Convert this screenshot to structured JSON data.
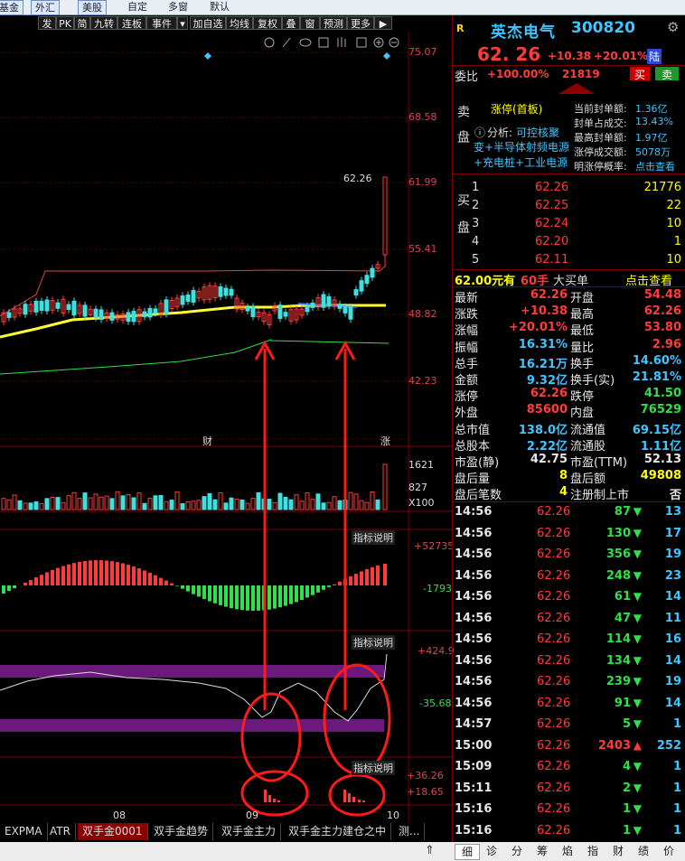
{
  "top_menu": {
    "items": [
      "基金",
      "外汇",
      "美股",
      "自定",
      "多窗",
      "默认"
    ]
  },
  "toolbar": {
    "buttons": [
      "发",
      "PK",
      "简",
      "九转",
      "连板",
      "事件",
      "▾",
      "加自选",
      "均线",
      "复权",
      "叠",
      "窗",
      "预测",
      "更多",
      "▶"
    ]
  },
  "chart_axis": {
    "price_ticks": [
      "75.07",
      "68.58",
      "61.99",
      "55.41",
      "48.82",
      "42.23"
    ],
    "high_label": "62.26",
    "marker_cai": "财",
    "marker_zhang": "涨"
  },
  "volume_panel": {
    "ticks": [
      "1621",
      "827",
      "X100"
    ]
  },
  "indicator1": {
    "button": "指标说明",
    "ticks": [
      "+52735",
      "-1793"
    ]
  },
  "indicator2": {
    "button": "指标说明",
    "ticks": [
      "+424.9",
      "-35.68"
    ]
  },
  "indicator3": {
    "button": "指标说明",
    "ticks": [
      "+36.26",
      "+18.65"
    ]
  },
  "date_axis": [
    "08",
    "09",
    "10"
  ],
  "bottom_tabs": [
    "EXPMA",
    "ATR",
    "双手金0001",
    "双手金趋势",
    "双手金主力",
    "双手金主力建仓之中",
    "测..."
  ],
  "stock": {
    "logo": "R",
    "name": "英杰电气",
    "code": "300820",
    "price": "62. 26",
    "change": "+10.38",
    "change_pct": "+20.01%",
    "board_tag": "陆",
    "weibi_label": "委比",
    "weibi_value": "+100.00%",
    "weicha_value": "21819",
    "sell_btn": "买",
    "buy_btn": "卖"
  },
  "limit_info": {
    "side_label_sell": "卖盘",
    "status": "涨停(首板)",
    "analysis_label": "分析:",
    "analysis_value": "可控核聚",
    "concept1": "变+半导体射频电源",
    "concept2": "+充电桩+工业电源",
    "stats": [
      {
        "label": "当前封单额:",
        "value": "1.36亿"
      },
      {
        "label": "封单占成交:",
        "value": "13.43%"
      },
      {
        "label": "最高封单额:",
        "value": "1.97亿"
      },
      {
        "label": "涨停成交额:",
        "value": "5078万"
      },
      {
        "label": "明涨停概率:",
        "value": "点击查看"
      }
    ]
  },
  "buy_book": {
    "side_label": "买盘",
    "rows": [
      {
        "level": "1",
        "price": "62.26",
        "vol": "21776"
      },
      {
        "level": "2",
        "price": "62.25",
        "vol": "22"
      },
      {
        "level": "3",
        "price": "62.24",
        "vol": "10"
      },
      {
        "level": "4",
        "price": "62.20",
        "vol": "1"
      },
      {
        "level": "5",
        "price": "62.11",
        "vol": "10"
      }
    ]
  },
  "big_order": {
    "amount": "62.00元有",
    "hands": "60手",
    "label": "大买单",
    "link": "点击查看"
  },
  "quote": [
    {
      "l1": "最新",
      "v1": "62.26",
      "l2": "开盘",
      "v2": "54.48",
      "c1": "red",
      "c2": "red"
    },
    {
      "l1": "涨跌",
      "v1": "+10.38",
      "l2": "最高",
      "v2": "62.26",
      "c1": "red",
      "c2": "red"
    },
    {
      "l1": "涨幅",
      "v1": "+20.01%",
      "l2": "最低",
      "v2": "53.80",
      "c1": "red",
      "c2": "red"
    },
    {
      "l1": "振幅",
      "v1": "16.31%",
      "l2": "量比",
      "v2": "2.96",
      "c1": "cyan",
      "c2": "red"
    },
    {
      "l1": "总手",
      "v1": "16.21万",
      "l2": "换手",
      "v2": "14.60%",
      "c1": "cyan",
      "c2": "cyan"
    },
    {
      "l1": "金额",
      "v1": "9.32亿",
      "l2": "换手(实)",
      "v2": "21.81%",
      "c1": "cyan",
      "c2": "cyan"
    },
    {
      "l1": "涨停",
      "v1": "62.26",
      "l2": "跌停",
      "v2": "41.50",
      "c1": "red",
      "c2": "green"
    },
    {
      "l1": "外盘",
      "v1": "85600",
      "l2": "内盘",
      "v2": "76529",
      "c1": "red",
      "c2": "green"
    },
    {
      "l1": "总市值",
      "v1": "138.0亿",
      "l2": "流通值",
      "v2": "69.15亿",
      "c1": "cyan",
      "c2": "cyan"
    },
    {
      "l1": "总股本",
      "v1": "2.22亿",
      "l2": "流通股",
      "v2": "1.11亿",
      "c1": "cyan",
      "c2": "cyan"
    },
    {
      "l1": "市盈(静)",
      "v1": "42.75",
      "l2": "市盈(TTM)",
      "v2": "52.13",
      "c1": "white",
      "c2": "white"
    },
    {
      "l1": "盘后量",
      "v1": "8",
      "l2": "盘后额",
      "v2": "49808",
      "c1": "yellow",
      "c2": "yellow"
    },
    {
      "l1": "盘后笔数",
      "v1": "4",
      "l2": "注册制上市",
      "v2": "否",
      "c1": "yellow",
      "c2": "white"
    }
  ],
  "ticks": [
    {
      "time": "14:56",
      "price": "62.26",
      "vol": "87",
      "dir": "down",
      "n": "13"
    },
    {
      "time": "14:56",
      "price": "62.26",
      "vol": "130",
      "dir": "down",
      "n": "17"
    },
    {
      "time": "14:56",
      "price": "62.26",
      "vol": "356",
      "dir": "down",
      "n": "19"
    },
    {
      "time": "14:56",
      "price": "62.26",
      "vol": "248",
      "dir": "down",
      "n": "23"
    },
    {
      "time": "14:56",
      "price": "62.26",
      "vol": "61",
      "dir": "down",
      "n": "14"
    },
    {
      "time": "14:56",
      "price": "62.26",
      "vol": "47",
      "dir": "down",
      "n": "11"
    },
    {
      "time": "14:56",
      "price": "62.26",
      "vol": "114",
      "dir": "down",
      "n": "16"
    },
    {
      "time": "14:56",
      "price": "62.26",
      "vol": "134",
      "dir": "down",
      "n": "14"
    },
    {
      "time": "14:56",
      "price": "62.26",
      "vol": "239",
      "dir": "down",
      "n": "19"
    },
    {
      "time": "14:56",
      "price": "62.26",
      "vol": "91",
      "dir": "down",
      "n": "14"
    },
    {
      "time": "14:57",
      "price": "62.26",
      "vol": "5",
      "dir": "down",
      "n": "1"
    },
    {
      "time": "15:00",
      "price": "62.26",
      "vol": "2403",
      "dir": "up",
      "n": "252"
    },
    {
      "time": "15:09",
      "price": "62.26",
      "vol": "4",
      "dir": "down",
      "n": "1"
    },
    {
      "time": "15:11",
      "price": "62.26",
      "vol": "2",
      "dir": "down",
      "n": "1"
    },
    {
      "time": "15:16",
      "price": "62.26",
      "vol": "1",
      "dir": "down",
      "n": "1"
    },
    {
      "time": "15:16",
      "price": "62.26",
      "vol": "1",
      "dir": "down",
      "n": "1"
    }
  ],
  "status_tabs": [
    "细",
    "诊",
    "分",
    "筹",
    "焰",
    "指",
    "财",
    "绩",
    "价"
  ],
  "colors": {
    "up": "#ff3b3b",
    "down": "#2ee04a",
    "accent": "#3fc5ff",
    "annotation": "#ff1a1a",
    "band": "#6a1a7a"
  }
}
